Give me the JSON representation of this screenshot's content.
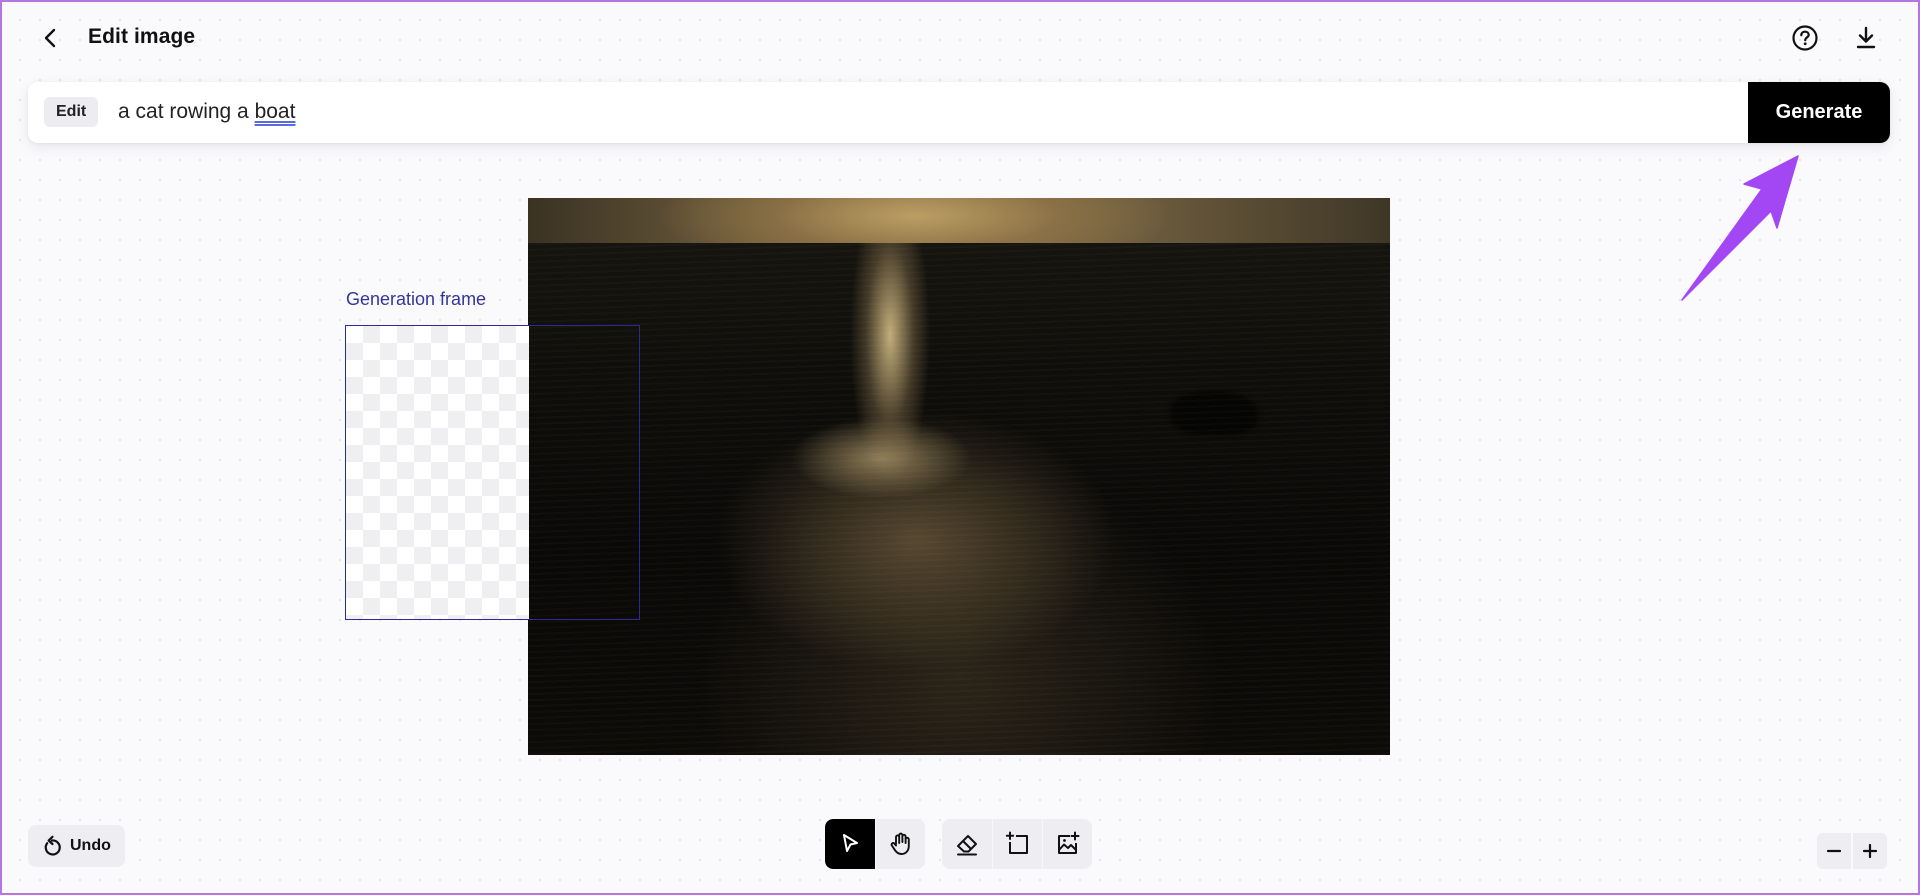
{
  "header": {
    "title": "Edit image",
    "back_icon": "chevron-left-icon",
    "help_icon": "question-circle-icon",
    "download_icon": "download-icon"
  },
  "prompt_bar": {
    "mode_label": "Edit",
    "prompt_text_before": "a cat rowing a ",
    "prompt_text_flagged": "boat",
    "generate_label": "Generate"
  },
  "canvas": {
    "image_description": "Sunset over dark sea with golden light reflection",
    "generation_frame_label": "Generation frame"
  },
  "annotation": {
    "arrow_color": "#a347f5",
    "points_to": "generate-button"
  },
  "bottom_toolbar": {
    "undo_label": "Undo",
    "undo_icon": "undo-icon",
    "tools": [
      {
        "name": "select",
        "icon": "cursor-arrow-icon",
        "active": true
      },
      {
        "name": "pan",
        "icon": "hand-icon",
        "active": false
      },
      {
        "name": "eraser",
        "icon": "eraser-icon",
        "active": false
      },
      {
        "name": "add-frame",
        "icon": "add-frame-icon",
        "active": false
      },
      {
        "name": "upload-image",
        "icon": "add-image-icon",
        "active": false
      }
    ],
    "zoom_out_icon": "minus-icon",
    "zoom_in_icon": "plus-icon"
  },
  "colors": {
    "accent_frame": "#2b2c8f",
    "frame_label": "#34359a",
    "generate_bg": "#000000",
    "screenshot_border": "#b775e0"
  }
}
